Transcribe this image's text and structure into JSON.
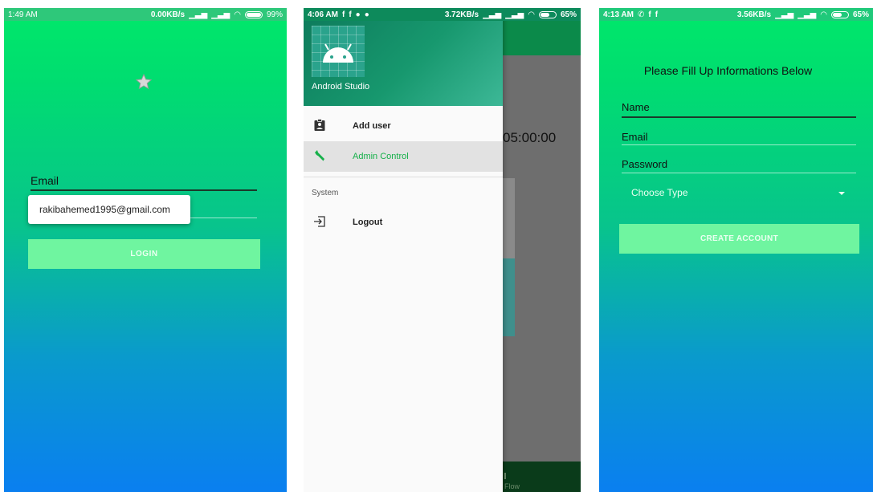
{
  "screen1": {
    "status": {
      "time": "1:49 AM",
      "speed": "0.00KB/s",
      "battery": "99%"
    },
    "email_label": "Email",
    "autofill_suggestion": "rakibahemed1995@gmail.com",
    "login_label": "LOGIN"
  },
  "screen2": {
    "status": {
      "time": "4:06 AM",
      "speed": "3.72KB/s",
      "battery": "65%"
    },
    "drawer": {
      "title": "Android Studio",
      "items": [
        {
          "label": "Add user",
          "icon": "assignment-ind-icon"
        },
        {
          "label": "Admin Control",
          "icon": "wrench-icon"
        }
      ],
      "section_label": "System",
      "logout_label": "Logout"
    },
    "background": {
      "timer": "05:00:00",
      "bottom_label": "Flow"
    }
  },
  "screen3": {
    "status": {
      "time": "4:13 AM",
      "speed": "3.56KB/s",
      "battery": "65%"
    },
    "title": "Please Fill Up Informations Below",
    "name_label": "Name",
    "email_label": "Email",
    "password_label": "Password",
    "choose_type_label": "Choose Type",
    "create_label": "CREATE ACCOUNT"
  },
  "colors": {
    "gradient_top": "#00e86a",
    "gradient_bottom": "#0a7ff0",
    "button_green": "#6ff5a0",
    "accent_green": "#16b04a",
    "drawer_header": "#0d7a5b"
  }
}
